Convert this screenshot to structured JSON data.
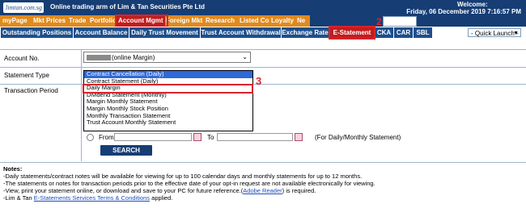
{
  "header": {
    "logo": "limtan.com.sg",
    "tagline": "Online trading arm of Lim & Tan Securities Pte Ltd",
    "welcome": "Welcome:",
    "datetime": "Friday, 06 December 2019 7:16:57 PM"
  },
  "nav_main": [
    "myPage",
    "Mkt Prices",
    "Trade",
    "Portfolio",
    "Account Mgmt",
    "Foreign Mkt",
    "Research",
    "Listed Co",
    "Loyalty",
    "Ne"
  ],
  "nav_sub": [
    "Outstanding Positions",
    "Account Balance",
    "Daily Trust Movement",
    "Trust Account Withdrawal",
    "Exchange Rate",
    "E-Statement",
    "CKA",
    "CAR",
    "SBL"
  ],
  "quick_launch": "- Quick Launch -",
  "annotations": {
    "n2": "2",
    "n3": "3"
  },
  "form": {
    "account_label": "Account No.",
    "account_value": "(online Margin)",
    "statement_label": "Statement Type",
    "period_label": "Transaction Period",
    "statement_options": [
      "Contract Cancellation (Daily)",
      "Contract Statement (Daily)",
      "Daily Margin",
      "Dividend Statement (Monthly)",
      "Margin Monthly Statement",
      "Margin Monthly Stock Position",
      "Monthly Transaction Statement",
      "Trust Account Monthly Statement"
    ],
    "from_label": "From",
    "to_label": "To",
    "period_hint": "(For Daily/Monthly Statement)",
    "search_label": "SEARCH"
  },
  "notes": {
    "title": "Notes:",
    "line1": "-Daily statements/contract notes will be available for viewing for up to 100 calendar days and monthly statements for up to 12 months.",
    "line2": "-The statements or notes for transaction periods prior to the effective date of your opt-in request are not available electronically for viewing.",
    "line3_pre": "-View, print your statement online, or download and save to your PC for future reference.(",
    "line3_link": "Adobe Reader",
    "line3_post": ") is required.",
    "line4_pre": "-Lim & Tan ",
    "line4_link": "E-Statements Services Terms & Conditions",
    "line4_post": " applied."
  },
  "colors": {
    "nav_blue": "#163d74",
    "nav_orange": "#e08a1e",
    "active_red": "#c21d1d",
    "select_blue": "#3069d8"
  }
}
